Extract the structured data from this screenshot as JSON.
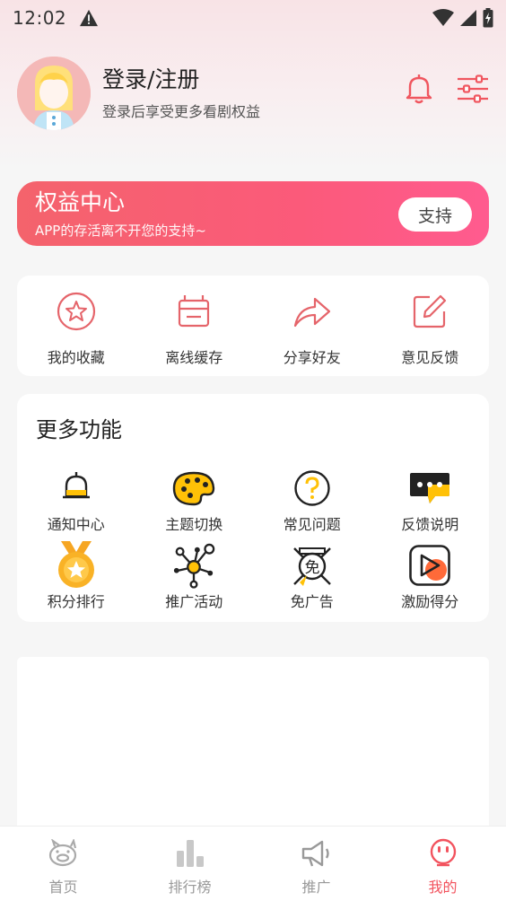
{
  "status_bar": {
    "time": "12:02"
  },
  "profile": {
    "login_title": "登录/注册",
    "login_subtitle": "登录后享受更多看剧权益"
  },
  "rights_banner": {
    "title": "权益中心",
    "subtitle": "APP的存活离不开您的支持~",
    "button_label": "支持"
  },
  "quick_actions": [
    {
      "label": "我的收藏",
      "icon": "star-circle-icon"
    },
    {
      "label": "离线缓存",
      "icon": "download-box-icon"
    },
    {
      "label": "分享好友",
      "icon": "share-arrow-icon"
    },
    {
      "label": "意见反馈",
      "icon": "edit-icon"
    }
  ],
  "more_features": {
    "title": "更多功能",
    "items": [
      {
        "label": "通知中心",
        "icon": "bell-icon"
      },
      {
        "label": "主题切换",
        "icon": "palette-icon"
      },
      {
        "label": "常见问题",
        "icon": "question-icon"
      },
      {
        "label": "反馈说明",
        "icon": "chat-bubble-icon"
      },
      {
        "label": "积分排行",
        "icon": "medal-icon"
      },
      {
        "label": "推广活动",
        "icon": "network-icon"
      },
      {
        "label": "免广告",
        "icon": "no-ads-icon"
      },
      {
        "label": "激励得分",
        "icon": "play-reward-icon"
      }
    ]
  },
  "tabbar": {
    "tabs": [
      {
        "label": "首页",
        "icon": "pig-home-icon",
        "active": false
      },
      {
        "label": "排行榜",
        "icon": "bar-chart-icon",
        "active": false
      },
      {
        "label": "推广",
        "icon": "megaphone-icon",
        "active": false
      },
      {
        "label": "我的",
        "icon": "profile-face-icon",
        "active": true
      }
    ]
  },
  "colors": {
    "accent": "#f2535e",
    "banner_start": "#f4636c",
    "banner_end": "#ff5b8f",
    "icon_line": "#e5646a",
    "feature_yellow": "#ffc107"
  }
}
